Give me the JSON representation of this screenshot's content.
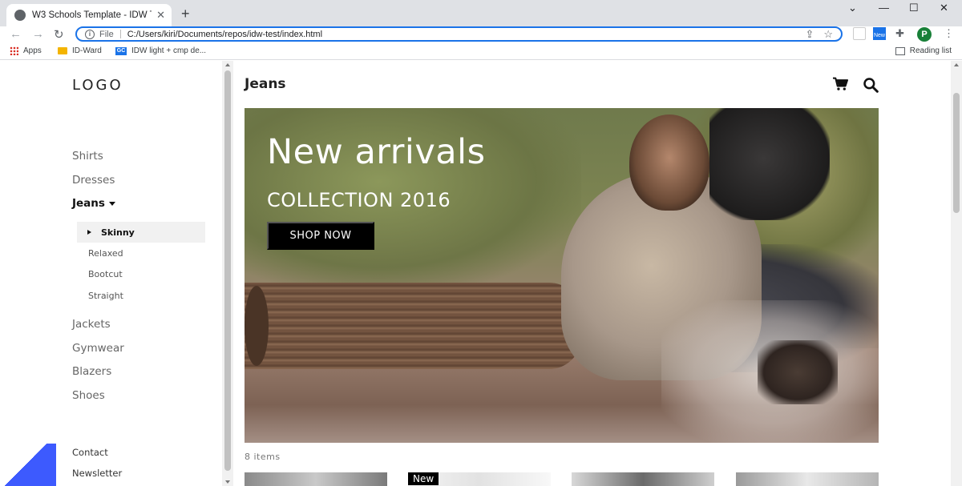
{
  "browser": {
    "tab_title": "W3 Schools Template - IDW Tech",
    "new_tab_symbol": "+",
    "address_scheme": "File",
    "address_path": "C:/Users/kiri/Documents/repos/idw-test/index.html",
    "profile_initial": "P",
    "ext_badge": "New",
    "bookmarks": [
      {
        "label": "Apps",
        "icon": "apps-grid-icon"
      },
      {
        "label": "ID-Ward",
        "icon": "folder-icon"
      },
      {
        "label": "IDW light + cmp de...",
        "icon": "gc-icon"
      }
    ],
    "reading_list": "Reading list"
  },
  "sidebar": {
    "logo": "LOGO",
    "categories": [
      "Shirts",
      "Dresses",
      "Jeans",
      "Jackets",
      "Gymwear",
      "Blazers",
      "Shoes"
    ],
    "active_category": "Jeans",
    "subcategories": [
      "Skinny",
      "Relaxed",
      "Bootcut",
      "Straight"
    ],
    "active_subcategory": "Skinny",
    "footer_links": [
      "Contact",
      "Newsletter"
    ]
  },
  "main": {
    "title": "Jeans",
    "hero": {
      "headline": "New arrivals",
      "subheadline": "COLLECTION 2016",
      "button": "SHOP NOW"
    },
    "item_count": "8 items",
    "products": [
      {
        "badge": ""
      },
      {
        "badge": "New"
      },
      {
        "badge": ""
      },
      {
        "badge": ""
      }
    ]
  },
  "colors": {
    "accent": "#3d5afe",
    "omnibox_border": "#1a73e8",
    "hero_button": "#000000"
  }
}
